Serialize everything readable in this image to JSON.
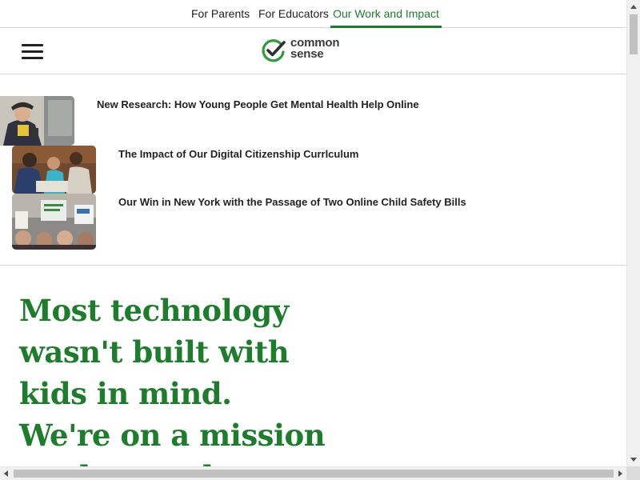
{
  "topnav": {
    "items": [
      {
        "label": "For Parents"
      },
      {
        "label": "For Educators"
      },
      {
        "label": "Our Work and Impact",
        "active": true
      }
    ]
  },
  "header": {
    "menu_icon": "hamburger-menu-icon",
    "logo": {
      "line1": "common",
      "line2": "sense",
      "icon": "checkmark-circle-icon"
    }
  },
  "news": {
    "items": [
      {
        "title": "New Research: How Young People Get Mental Health Help Online"
      },
      {
        "title": "The Impact of Our Digital Citizenship Currlculum"
      },
      {
        "title": "Our Win in New York with the Passage of Two Online Child Safety Bills"
      }
    ]
  },
  "hero": {
    "lines": [
      "Most technology",
      "wasn't built with",
      "kids in mind.",
      "We're on a mission",
      "to change that."
    ]
  },
  "colors": {
    "brand_green": "#1e7d2c",
    "text": "#222222",
    "divider": "#d6d6d6"
  }
}
